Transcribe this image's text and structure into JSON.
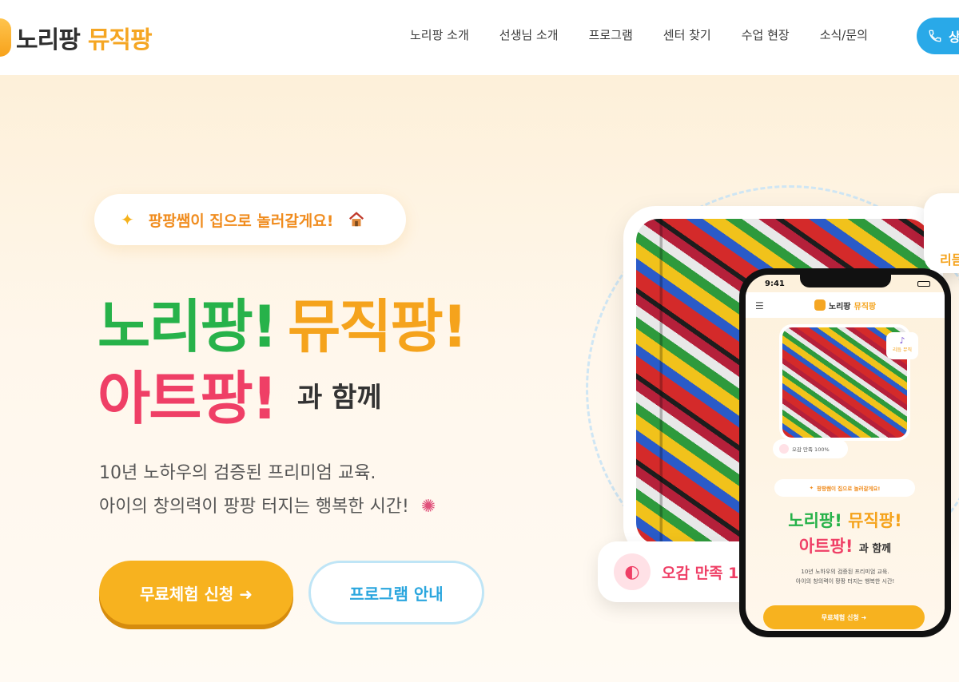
{
  "header": {
    "logo_main": "노리팡",
    "logo_accent": "뮤직팡",
    "nav": [
      {
        "label": "노리팡 소개"
      },
      {
        "label": "선생님 소개"
      },
      {
        "label": "프로그램"
      },
      {
        "label": "센터 찾기"
      },
      {
        "label": "수업 현장"
      },
      {
        "label": "소식/문의"
      }
    ],
    "call_button_label": "상",
    "call_icon": "phone-icon"
  },
  "hero": {
    "badge_text": "팡팡쌤이 집으로 놀러갈게요!",
    "badge_left_icon": "sparkle-icon",
    "badge_right_icon": "house-icon",
    "title_1": "노리팡!",
    "title_2": "뮤직팡!",
    "title_3": "아트팡!",
    "title_suffix": "과 함께",
    "desc_1": "10년 노하우의 검증된 프리미엄 교육.",
    "desc_2": "아이의 창의력이 팡팡 터지는 행복한 시간!",
    "desc_icon": "party-popper-icon",
    "primary_button": "무료체험 신청 ➜",
    "secondary_button": "프로그램 안내",
    "colors": {
      "green": "#27b24a",
      "orange": "#f5a31c",
      "pink": "#ef3f66",
      "blue": "#2aa6de"
    }
  },
  "visual": {
    "side_card_text": "리듬",
    "satisfaction_text": "오감 만족 10",
    "satisfaction_icon": "palette-icon"
  },
  "phone": {
    "time": "9:41",
    "logo_main": "노리팡",
    "logo_accent": "뮤직팡",
    "note_text": "리듬 뮤직",
    "note_icon": "music-note-icon",
    "satisfaction": "오감 만족 100%",
    "badge_text": "팡팡쌤이 집으로 놀러갈게요!",
    "title_1": "노리팡!",
    "title_2": "뮤직팡!",
    "title_3": "아트팡!",
    "title_suffix": "과 함께",
    "desc_1": "10년 노하우의 검증된 프리미엄 교육.",
    "desc_2": "아이의 창의력이 팡팡 터지는 행복한 시간!",
    "button": "무료체험 신청 ➜"
  }
}
